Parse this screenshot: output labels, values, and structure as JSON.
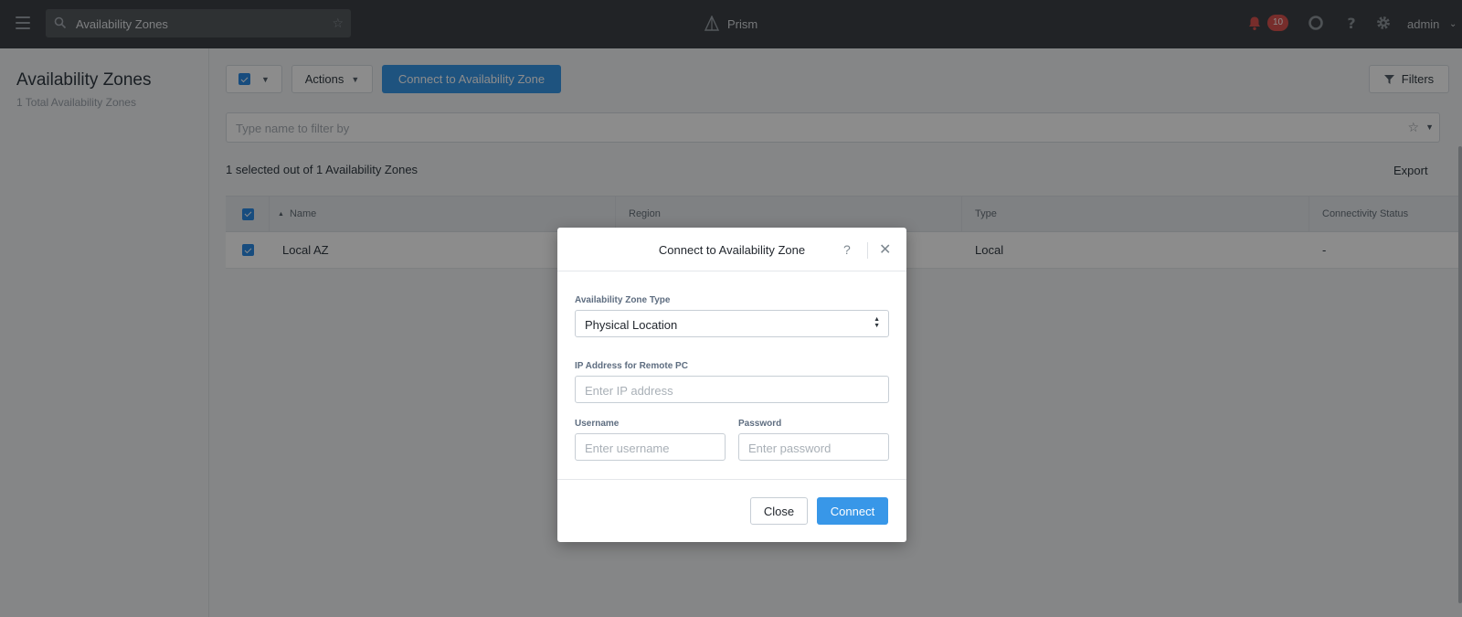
{
  "topbar": {
    "search_value": "Availability Zones",
    "brand": "Prism",
    "alert_count": "10",
    "user": "admin"
  },
  "left": {
    "title": "Availability Zones",
    "subtitle": "1 Total Availability Zones"
  },
  "toolbar": {
    "actions_label": "Actions",
    "connect_label": "Connect to Availability Zone",
    "filters_label": "Filters",
    "filter_placeholder": "Type name to filter by",
    "selected_text": "1 selected out of 1 Availability Zones",
    "export_label": "Export"
  },
  "table": {
    "columns": [
      "Name",
      "Region",
      "Type",
      "Connectivity Status"
    ],
    "rows": [
      {
        "name": "Local AZ",
        "region": "",
        "type": "Local",
        "status": "-"
      }
    ]
  },
  "modal": {
    "title": "Connect to Availability Zone",
    "help": "?",
    "az_type_label": "Availability Zone Type",
    "az_type_value": "Physical Location",
    "ip_label": "IP Address for Remote PC",
    "ip_placeholder": "Enter IP address",
    "username_label": "Username",
    "username_placeholder": "Enter username",
    "password_label": "Password",
    "password_placeholder": "Enter password",
    "close_label": "Close",
    "connect_label": "Connect"
  },
  "colors": {
    "topbar": "#3d4145",
    "accent": "#3897e8",
    "badge": "#d9534f"
  }
}
